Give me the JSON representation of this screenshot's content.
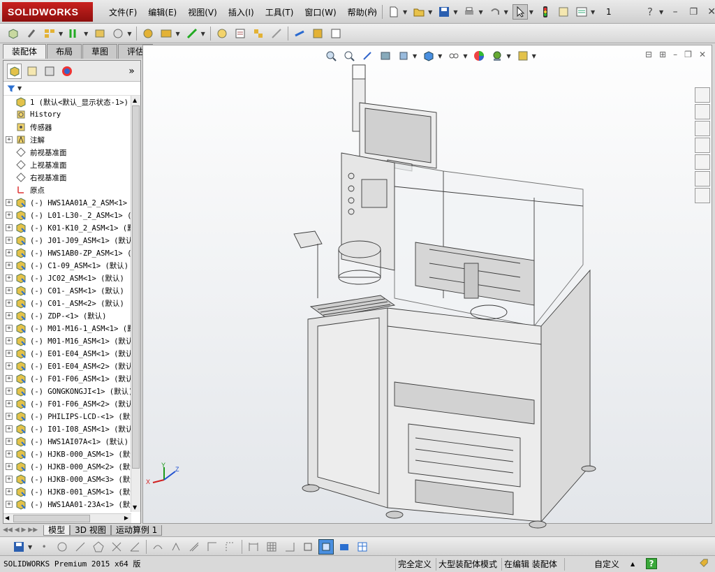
{
  "app": {
    "logo_text": "SOLIDWORKS",
    "brand_color": "#b51b19"
  },
  "menu": [
    "文件(F)",
    "编辑(E)",
    "视图(V)",
    "插入(I)",
    "工具(T)",
    "窗口(W)",
    "帮助(H)"
  ],
  "title_field": "1",
  "tabs": [
    "装配体",
    "布局",
    "草图",
    "评估"
  ],
  "tree": {
    "root": "1  (默认<默认_显示状态-1>)",
    "features": [
      {
        "label": "History",
        "icon": "history-icon",
        "expand": ""
      },
      {
        "label": "传感器",
        "icon": "sensor-icon",
        "expand": ""
      },
      {
        "label": "注解",
        "icon": "annotation-icon",
        "expand": "+"
      },
      {
        "label": "前视基准面",
        "icon": "plane-icon",
        "expand": ""
      },
      {
        "label": "上视基准面",
        "icon": "plane-icon",
        "expand": ""
      },
      {
        "label": "右视基准面",
        "icon": "plane-icon",
        "expand": ""
      },
      {
        "label": "原点",
        "icon": "origin-icon",
        "expand": ""
      }
    ],
    "components": [
      "(-) HWS1AA01A_2_ASM<1> (默认",
      "(-) L01-L30-_2_ASM<1> (默认",
      "(-) K01-K10_2_ASM<1> (默认",
      "(-) J01-J09_ASM<1> (默认",
      "(-) HWS1AB0-ZP_ASM<1> (默认",
      "(-) C1-09_ASM<1> (默认)",
      "(-) JC02_ASM<1> (默认)",
      "(-) C01-_ASM<1> (默认)",
      "(-) C01-_ASM<2> (默认)",
      "(-) ZDP-<1> (默认)",
      "(-) M01-M16-1_ASM<1> (默认",
      "(-) M01-M16_ASM<1> (默认",
      "(-) E01-E04_ASM<1> (默认",
      "(-) E01-E04_ASM<2> (默认",
      "(-) F01-F06_ASM<1> (默认",
      "(-) GONGKONGJI<1> (默认)",
      "(-) F01-F06_ASM<2> (默认",
      "(-) PHILIPS-LCD-<1> (默认",
      "(-) I01-I08_ASM<1> (默认",
      "(-) HWS1AI07A<1> (默认)",
      "(-) HJKB-000_ASM<1> (默认",
      "(-) HJKB-000_ASM<2> (默认",
      "(-) HJKB-000_ASM<3> (默认",
      "(-) HJKB-001_ASM<1> (默认",
      "(-) HWS1AA01-23A<1> (默认"
    ]
  },
  "bottom_tabs": [
    "模型",
    "3D 视图",
    "运动算例 1"
  ],
  "status": {
    "product": "SOLIDWORKS Premium 2015 x64 版",
    "defined": "完全定义",
    "mode": "大型装配体模式",
    "editing": "在编辑 装配体",
    "units": "自定义",
    "help": "?"
  },
  "triad": {
    "x": "X",
    "y": "Y",
    "z": "Z"
  }
}
